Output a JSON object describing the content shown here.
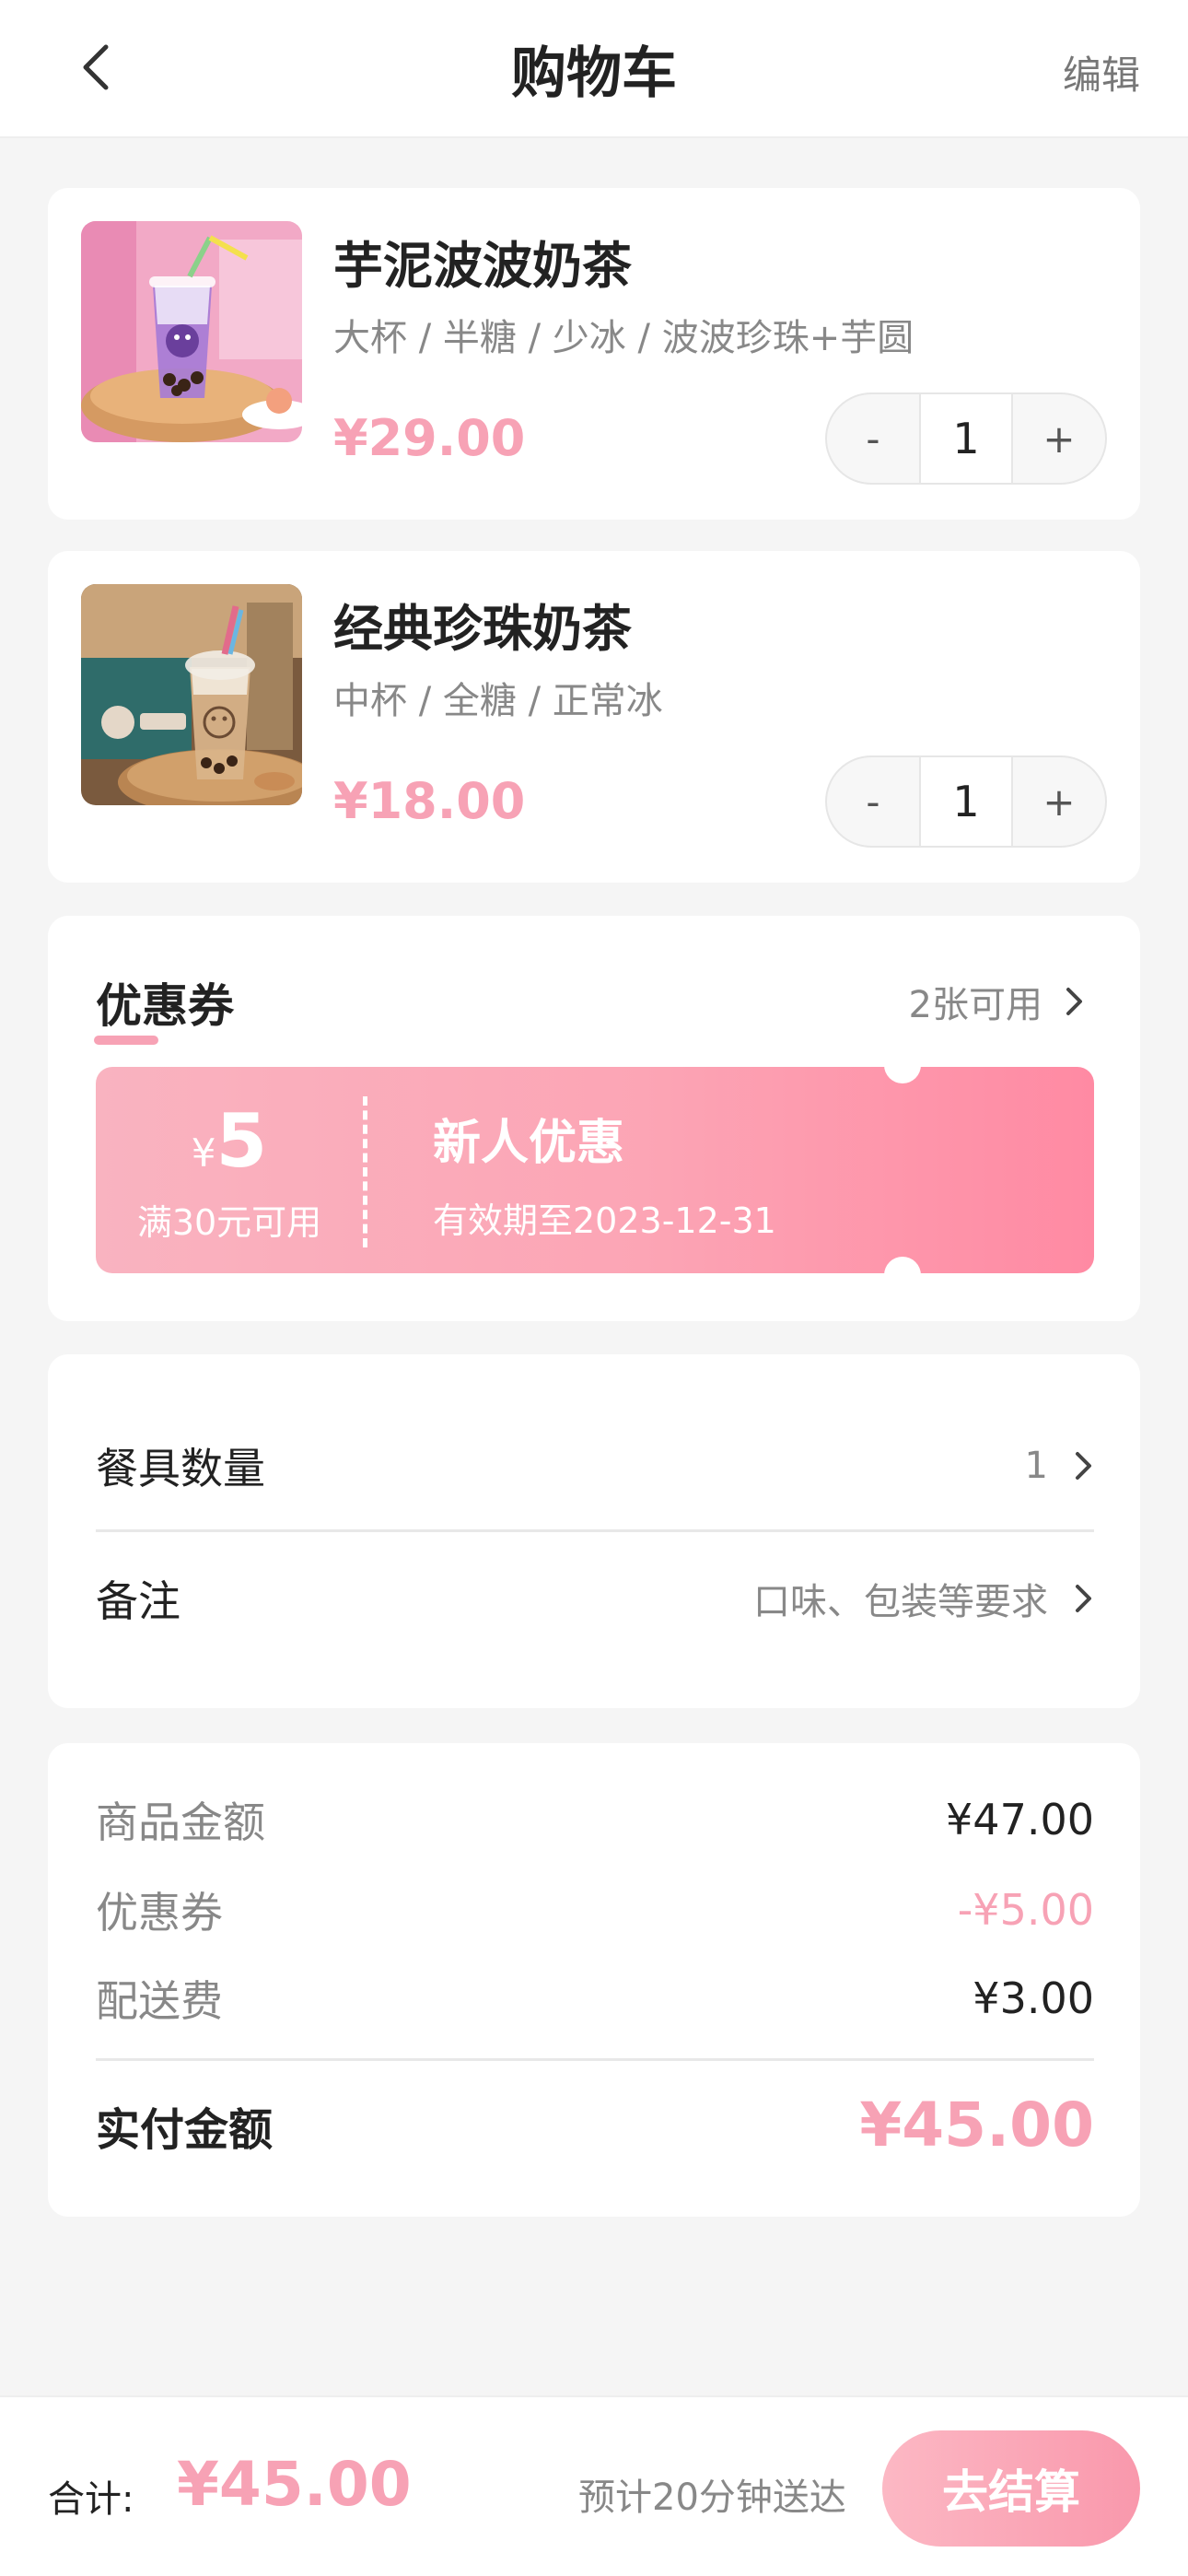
{
  "header": {
    "title": "购物车",
    "edit_label": "编辑"
  },
  "cart_items": [
    {
      "name": "芋泥波波奶茶",
      "spec": "大杯 / 半糖 / 少冰 / 波波珍珠+芋圆",
      "price": "¥29.00",
      "qty": "1",
      "minus": "-",
      "plus": "+"
    },
    {
      "name": "经典珍珠奶茶",
      "spec": "中杯 / 全糖 / 正常冰",
      "price": "¥18.00",
      "qty": "1",
      "minus": "-",
      "plus": "+"
    }
  ],
  "coupon": {
    "title": "优惠券",
    "available": "2张可用",
    "ticket": {
      "symbol": "¥",
      "amount": "5",
      "condition": "满30元可用",
      "name": "新人优惠",
      "expiry": "有效期至2023-12-31"
    }
  },
  "options": {
    "tableware_label": "餐具数量",
    "tableware_value": "1",
    "note_label": "备注",
    "note_placeholder": "口味、包装等要求"
  },
  "summary": {
    "goods_label": "商品金额",
    "goods_value": "¥47.00",
    "coupon_label": "优惠券",
    "coupon_value": "-¥5.00",
    "delivery_label": "配送费",
    "delivery_value": "¥3.00",
    "total_label": "实付金额",
    "total_value": "¥45.00"
  },
  "bottom_bar": {
    "total_label": "合计:",
    "total_value": "¥45.00",
    "eta": "预计20分钟送达",
    "checkout_label": "去结算"
  },
  "colors": {
    "accent": "#f7a2b5",
    "background": "#f5f5f5"
  }
}
